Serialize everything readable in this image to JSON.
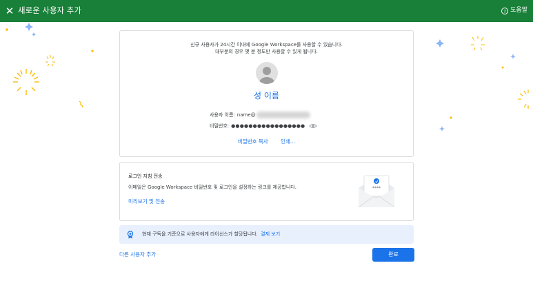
{
  "header": {
    "title": "새로운 사용자 추가",
    "close_icon": "close-icon",
    "help_label": "도움말",
    "background_color": "#188038"
  },
  "card1": {
    "line1": "신규 사용자가 24시간 이내에 Google Workspace를 사용할 수 있습니다.",
    "line2": "대부분의 경우 몇 분 정도만 사용할 수 있게 됩니다.",
    "user_full_name": "성 이름",
    "username_label": "사용자 이름:",
    "username_value": "name@",
    "password_label": "비밀번호:",
    "password_value": "●●●●●●●●●●●●●●●●●",
    "copy_password_label": "비밀번호 복사",
    "print_label": "인쇄..."
  },
  "card2": {
    "title": "로그인 지침 전송",
    "description": "이메일은 Google Workspace 비밀번호 및 로그인을 설정하는 링크를 제공합니다.",
    "preview_send_label": "미리보기 및 전송",
    "envelope_password": "****"
  },
  "banner": {
    "text": "현재 구독을 기준으로 사용자에게 라이선스가 할당됩니다.",
    "link_label": "결제 보기"
  },
  "footer": {
    "add_another_label": "다른 사용자 추가",
    "done_label": "완료"
  },
  "colors": {
    "accent": "#1a73e8",
    "banner_bg": "#e8f0fe",
    "confetti_yellow": "#fbbc04",
    "confetti_blue": "#8ab4f8"
  }
}
